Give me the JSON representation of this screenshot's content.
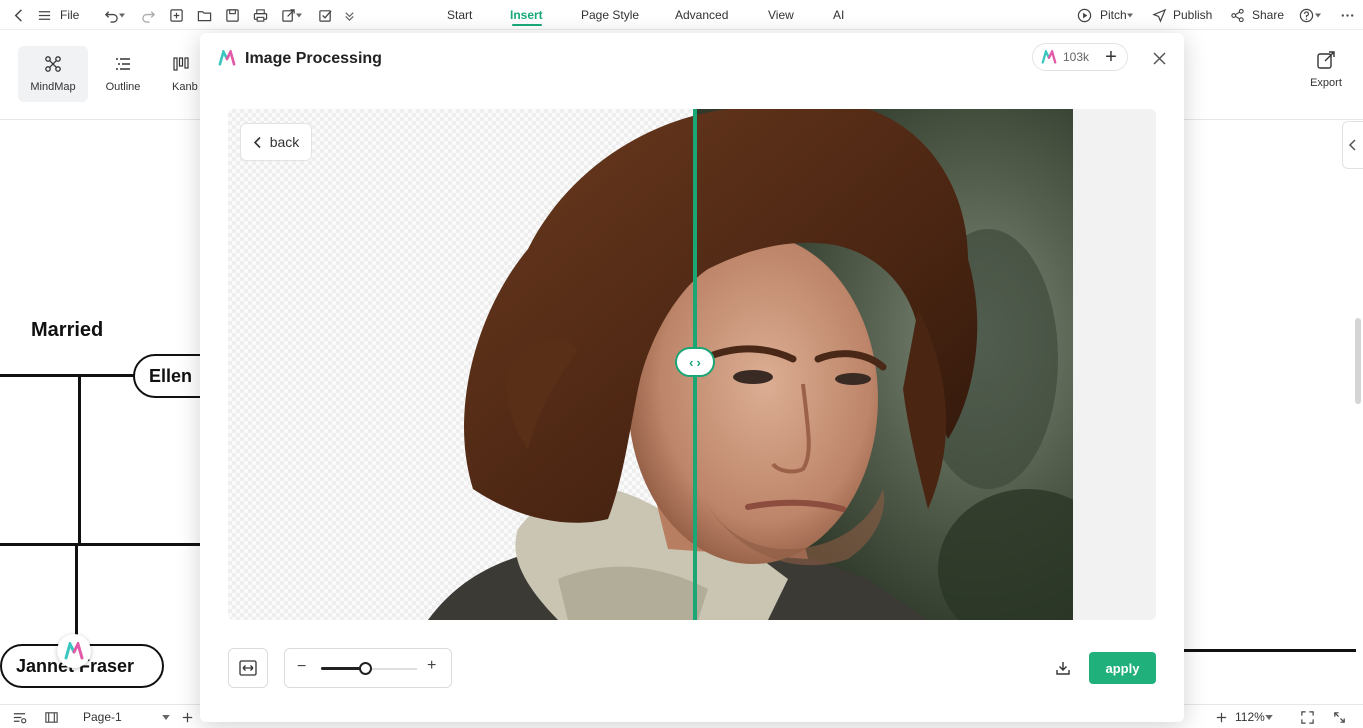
{
  "topbar": {
    "file_label": "File",
    "tabs": [
      {
        "label": "Start"
      },
      {
        "label": "Insert"
      },
      {
        "label": "Page Style"
      },
      {
        "label": "Advanced"
      },
      {
        "label": "View"
      },
      {
        "label": "AI"
      }
    ],
    "active_tab": "Insert",
    "pitch_label": "Pitch",
    "publish_label": "Publish",
    "share_label": "Share"
  },
  "toolbar": {
    "views": [
      {
        "label": "MindMap",
        "active": true
      },
      {
        "label": "Outline"
      },
      {
        "label": "Kanb"
      }
    ],
    "export_label": "Export"
  },
  "canvas": {
    "married_label": "Married",
    "node_ellen": "Ellen",
    "node_jannet": "Jannet Fraser"
  },
  "statusbar": {
    "page_label": "Page-1",
    "zoom_label": "112%"
  },
  "modal": {
    "title": "Image Processing",
    "credits": "103k",
    "back_label": "back",
    "apply_label": "apply",
    "zoom_level": 0.46
  },
  "colors": {
    "accent": "#1aaa7a",
    "apply_bg": "#1fb07c",
    "divider": "#1aa675"
  }
}
